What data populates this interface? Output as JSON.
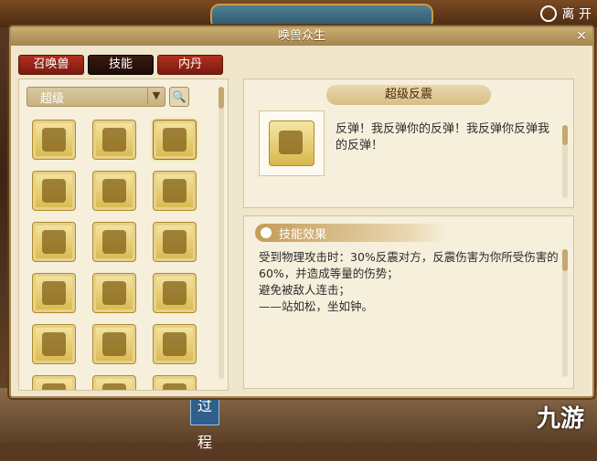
{
  "top": {
    "leave_label": "离 开"
  },
  "window": {
    "title": "唤兽众生",
    "close_glyph": "✕",
    "tabs": [
      {
        "label": "召唤兽",
        "active": false
      },
      {
        "label": "技能",
        "active": true
      },
      {
        "label": "内丹",
        "active": false
      }
    ],
    "filter": {
      "selected": "超级",
      "arrow_glyph": "▼",
      "search_glyph": "🔍"
    }
  },
  "skill_grid": {
    "rows": 6,
    "columns": 3,
    "selected_index": 2,
    "icons": [
      "eye-swirl-icon",
      "whirl-icon",
      "reflect-icon",
      "chest-icon",
      "cross-swords-icon",
      "wings-icon",
      "figure-icon",
      "mask-icon",
      "dragon-icon",
      "head-question-icon",
      "skull-icon",
      "beast-face-icon",
      "sun-head-icon",
      "sword-icon",
      "spiral-icon",
      "partial-icon-1",
      "partial-icon-2",
      "partial-icon-3"
    ]
  },
  "detail": {
    "skill_name": "超级反震",
    "description": "反弹！我反弹你的反弹！我反弹你反弹我的反弹！"
  },
  "effects": {
    "header": "技能效果",
    "lines": [
      "受到物理攻击时：30%反震对方，反震伤害为你所受伤害的60%，并造成等量的伤势；",
      "避免被敌人连击；",
      "——站如松，坐如钟。"
    ]
  },
  "background": {
    "side_text": "过程"
  },
  "watermark": "九游"
}
